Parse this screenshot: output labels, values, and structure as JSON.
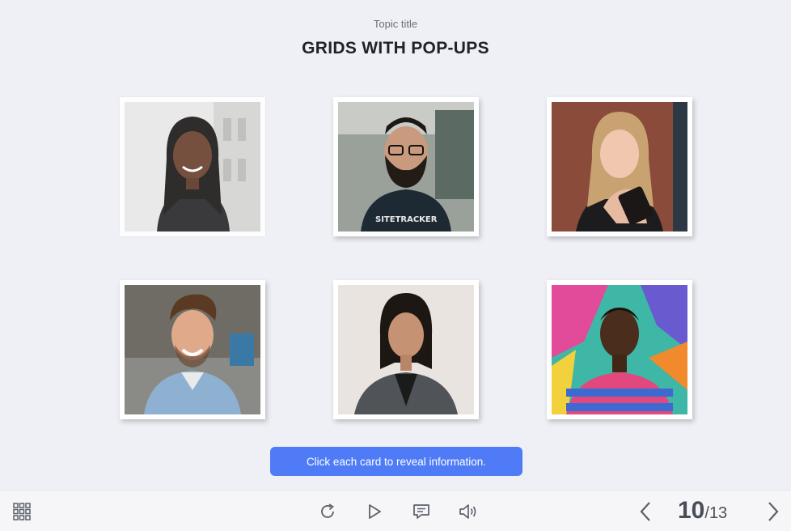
{
  "slide": {
    "topic_label": "Topic title",
    "title": "GRIDS WITH POP-UPS",
    "hint_label": "Click each card to reveal information."
  },
  "cards": [
    {
      "name": "card-woman-braids"
    },
    {
      "name": "card-man-beard-glasses"
    },
    {
      "name": "card-woman-blonde"
    },
    {
      "name": "card-man-smiling"
    },
    {
      "name": "card-woman-blazer"
    },
    {
      "name": "card-man-striped-shirt"
    }
  ],
  "player": {
    "current_page": "10",
    "page_separator": "/",
    "total_pages": "13",
    "colors": {
      "accent": "#4f7cf6",
      "icon": "#5b606b"
    },
    "icons": [
      "grid-menu-icon",
      "replay-icon",
      "play-icon",
      "captions-icon",
      "volume-icon",
      "prev-arrow-icon",
      "next-arrow-icon"
    ]
  }
}
